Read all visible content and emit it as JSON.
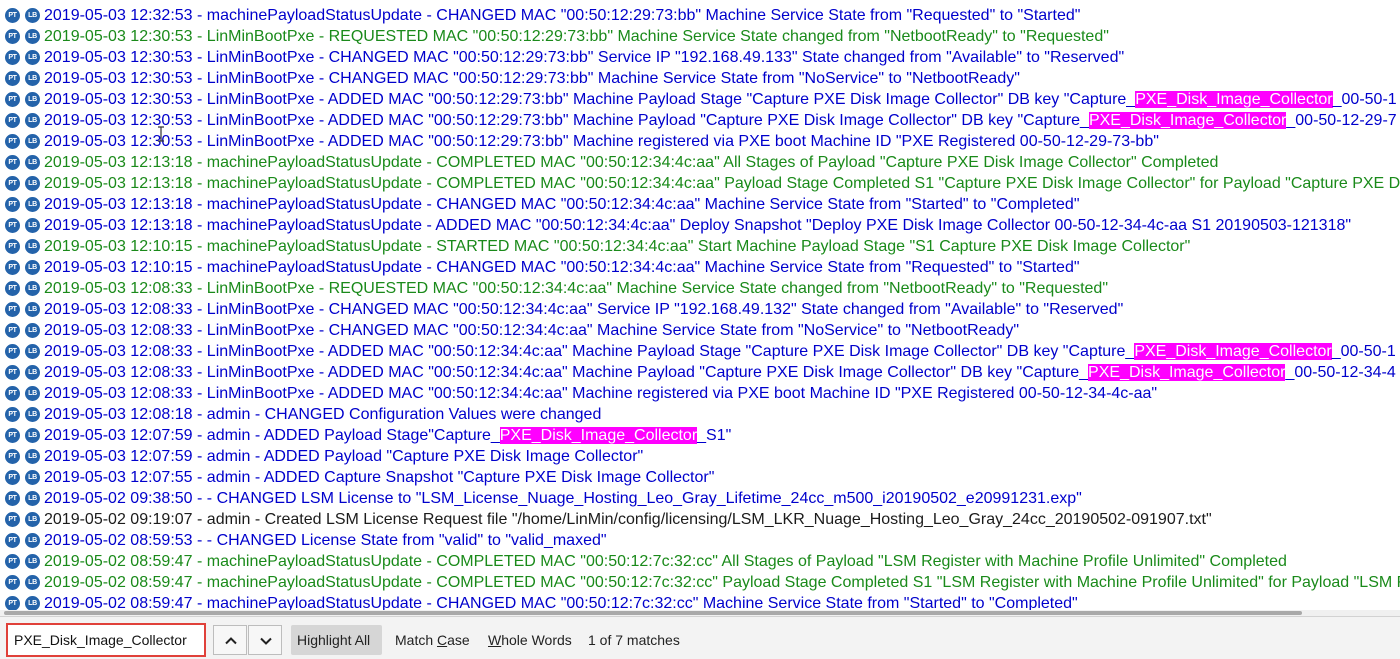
{
  "icons": {
    "pt": "PT",
    "lb": "LB"
  },
  "colors": {
    "blue": "#0000cc",
    "green": "#1a8a1a",
    "black": "#1b1b1b",
    "highlight": "#ff00ff",
    "find_border": "#e0413a"
  },
  "log_rows": [
    {
      "color": "blue",
      "segments": [
        {
          "text": "2019-05-03 12:32:53 - machinePayloadStatusUpdate - CHANGED MAC \"00:50:12:29:73:bb\" Machine Service State from \"Requested\" to \"Started\""
        }
      ]
    },
    {
      "color": "green",
      "segments": [
        {
          "text": "2019-05-03 12:30:53 - LinMinBootPxe - REQUESTED MAC \"00:50:12:29:73:bb\" Machine Service State changed from \"NetbootReady\" to \"Requested\""
        }
      ]
    },
    {
      "color": "blue",
      "segments": [
        {
          "text": "2019-05-03 12:30:53 - LinMinBootPxe - CHANGED MAC \"00:50:12:29:73:bb\" Service IP \"192.168.49.133\" State changed from \"Available\" to \"Reserved\""
        }
      ]
    },
    {
      "color": "blue",
      "segments": [
        {
          "text": "2019-05-03 12:30:53 - LinMinBootPxe - CHANGED MAC \"00:50:12:29:73:bb\" Machine Service State from \"NoService\" to \"NetbootReady\""
        }
      ]
    },
    {
      "color": "blue",
      "segments": [
        {
          "text": "2019-05-03 12:30:53 - LinMinBootPxe - ADDED MAC \"00:50:12:29:73:bb\" Machine Payload Stage \"Capture PXE Disk Image Collector\" DB key \"Capture_"
        },
        {
          "text": "PXE_Disk_Image_Collector",
          "hl": true
        },
        {
          "text": "_00-50-1"
        }
      ]
    },
    {
      "color": "blue",
      "segments": [
        {
          "text": "2019-05-03 12:30:53 - LinMinBootPxe - ADDED MAC \"00:50:12:29:73:bb\" Machine Payload \"Capture PXE Disk Image Collector\" DB key \"Capture_"
        },
        {
          "text": "PXE_Disk_Image_Collector",
          "hl": true
        },
        {
          "text": "_00-50-12-29-7"
        }
      ]
    },
    {
      "color": "blue",
      "segments": [
        {
          "text": "2019-05-03 12:30:53 - LinMinBootPxe - ADDED MAC \"00:50:12:29:73:bb\" Machine registered via PXE boot Machine ID \"PXE Registered 00-50-12-29-73-bb\""
        }
      ]
    },
    {
      "color": "green",
      "segments": [
        {
          "text": "2019-05-03 12:13:18 - machinePayloadStatusUpdate - COMPLETED MAC \"00:50:12:34:4c:aa\" All Stages of Payload \"Capture PXE Disk Image Collector\" Completed"
        }
      ]
    },
    {
      "color": "green",
      "segments": [
        {
          "text": "2019-05-03 12:13:18 - machinePayloadStatusUpdate - COMPLETED MAC \"00:50:12:34:4c:aa\" Payload Stage Completed S1 \"Capture PXE Disk Image Collector\" for Payload \"Capture PXE D"
        }
      ]
    },
    {
      "color": "blue",
      "segments": [
        {
          "text": "2019-05-03 12:13:18 - machinePayloadStatusUpdate - CHANGED MAC \"00:50:12:34:4c:aa\" Machine Service State from \"Started\" to \"Completed\""
        }
      ]
    },
    {
      "color": "blue",
      "segments": [
        {
          "text": "2019-05-03 12:13:18 - machinePayloadStatusUpdate - ADDED MAC \"00:50:12:34:4c:aa\" Deploy Snapshot \"Deploy PXE Disk Image Collector 00-50-12-34-4c-aa S1 20190503-121318\""
        }
      ]
    },
    {
      "color": "green",
      "segments": [
        {
          "text": "2019-05-03 12:10:15 - machinePayloadStatusUpdate - STARTED MAC \"00:50:12:34:4c:aa\" Start Machine Payload Stage \"S1 Capture PXE Disk Image Collector\""
        }
      ]
    },
    {
      "color": "blue",
      "segments": [
        {
          "text": "2019-05-03 12:10:15 - machinePayloadStatusUpdate - CHANGED MAC \"00:50:12:34:4c:aa\" Machine Service State from \"Requested\" to \"Started\""
        }
      ]
    },
    {
      "color": "green",
      "segments": [
        {
          "text": "2019-05-03 12:08:33 - LinMinBootPxe - REQUESTED MAC \"00:50:12:34:4c:aa\" Machine Service State changed from \"NetbootReady\" to \"Requested\""
        }
      ]
    },
    {
      "color": "blue",
      "segments": [
        {
          "text": "2019-05-03 12:08:33 - LinMinBootPxe - CHANGED MAC \"00:50:12:34:4c:aa\" Service IP \"192.168.49.132\" State changed from \"Available\" to \"Reserved\""
        }
      ]
    },
    {
      "color": "blue",
      "segments": [
        {
          "text": "2019-05-03 12:08:33 - LinMinBootPxe - CHANGED MAC \"00:50:12:34:4c:aa\" Machine Service State from \"NoService\" to \"NetbootReady\""
        }
      ]
    },
    {
      "color": "blue",
      "segments": [
        {
          "text": "2019-05-03 12:08:33 - LinMinBootPxe - ADDED MAC \"00:50:12:34:4c:aa\" Machine Payload Stage \"Capture PXE Disk Image Collector\" DB key \"Capture_"
        },
        {
          "text": "PXE_Disk_Image_Collector",
          "hl": true
        },
        {
          "text": "_00-50-1"
        }
      ]
    },
    {
      "color": "blue",
      "segments": [
        {
          "text": "2019-05-03 12:08:33 - LinMinBootPxe - ADDED MAC \"00:50:12:34:4c:aa\" Machine Payload \"Capture PXE Disk Image Collector\" DB key \"Capture_"
        },
        {
          "text": "PXE_Disk_Image_Collector",
          "hl": true
        },
        {
          "text": "_00-50-12-34-4"
        }
      ]
    },
    {
      "color": "blue",
      "segments": [
        {
          "text": "2019-05-03 12:08:33 - LinMinBootPxe - ADDED MAC \"00:50:12:34:4c:aa\" Machine registered via PXE boot Machine ID \"PXE Registered 00-50-12-34-4c-aa\""
        }
      ]
    },
    {
      "color": "blue",
      "segments": [
        {
          "text": "2019-05-03 12:08:18 - admin - CHANGED Configuration Values were changed"
        }
      ]
    },
    {
      "color": "blue",
      "segments": [
        {
          "text": "2019-05-03 12:07:59 - admin - ADDED Payload Stage\"Capture_"
        },
        {
          "text": "PXE_Disk_Image_Collector",
          "hl": true
        },
        {
          "text": "_S1\""
        }
      ]
    },
    {
      "color": "blue",
      "segments": [
        {
          "text": "2019-05-03 12:07:59 - admin - ADDED Payload \"Capture PXE Disk Image Collector\""
        }
      ]
    },
    {
      "color": "blue",
      "segments": [
        {
          "text": "2019-05-03 12:07:55 - admin - ADDED Capture Snapshot \"Capture PXE Disk Image Collector\""
        }
      ]
    },
    {
      "color": "blue",
      "segments": [
        {
          "text": "2019-05-02 09:38:50 - - CHANGED LSM License to \"LSM_License_Nuage_Hosting_Leo_Gray_Lifetime_24cc_m500_i20190502_e20991231.exp\""
        }
      ]
    },
    {
      "color": "black",
      "segments": [
        {
          "text": "2019-05-02 09:19:07 - admin - Created LSM License Request file \"/home/LinMin/config/licensing/LSM_LKR_Nuage_Hosting_Leo_Gray_24cc_20190502-091907.txt\""
        }
      ]
    },
    {
      "color": "blue",
      "segments": [
        {
          "text": "2019-05-02 08:59:53 - - CHANGED License State from \"valid\" to \"valid_maxed\""
        }
      ]
    },
    {
      "color": "green",
      "segments": [
        {
          "text": "2019-05-02 08:59:47 - machinePayloadStatusUpdate - COMPLETED MAC \"00:50:12:7c:32:cc\" All Stages of Payload \"LSM Register with Machine Profile Unlimited\" Completed"
        }
      ]
    },
    {
      "color": "green",
      "segments": [
        {
          "text": "2019-05-02 08:59:47 - machinePayloadStatusUpdate - COMPLETED MAC \"00:50:12:7c:32:cc\" Payload Stage Completed S1 \"LSM Register with Machine Profile Unlimited\" for Payload \"LSM R"
        }
      ]
    },
    {
      "color": "blue",
      "segments": [
        {
          "text": "2019-05-02 08:59:47 - machinePayloadStatusUpdate - CHANGED MAC \"00:50:12:7c:32:cc\" Machine Service State from \"Started\" to \"Completed\""
        }
      ]
    }
  ],
  "find_bar": {
    "query": "PXE_Disk_Image_Collector",
    "prev_icon": "chevron-up-icon",
    "next_icon": "chevron-down-icon",
    "highlight_all": {
      "label": "Highlight All",
      "active": true
    },
    "match_case": {
      "label": "Match Case",
      "active": false
    },
    "whole_words": {
      "label": "Whole Words",
      "active": false
    },
    "match_count": "1 of 7 matches"
  }
}
